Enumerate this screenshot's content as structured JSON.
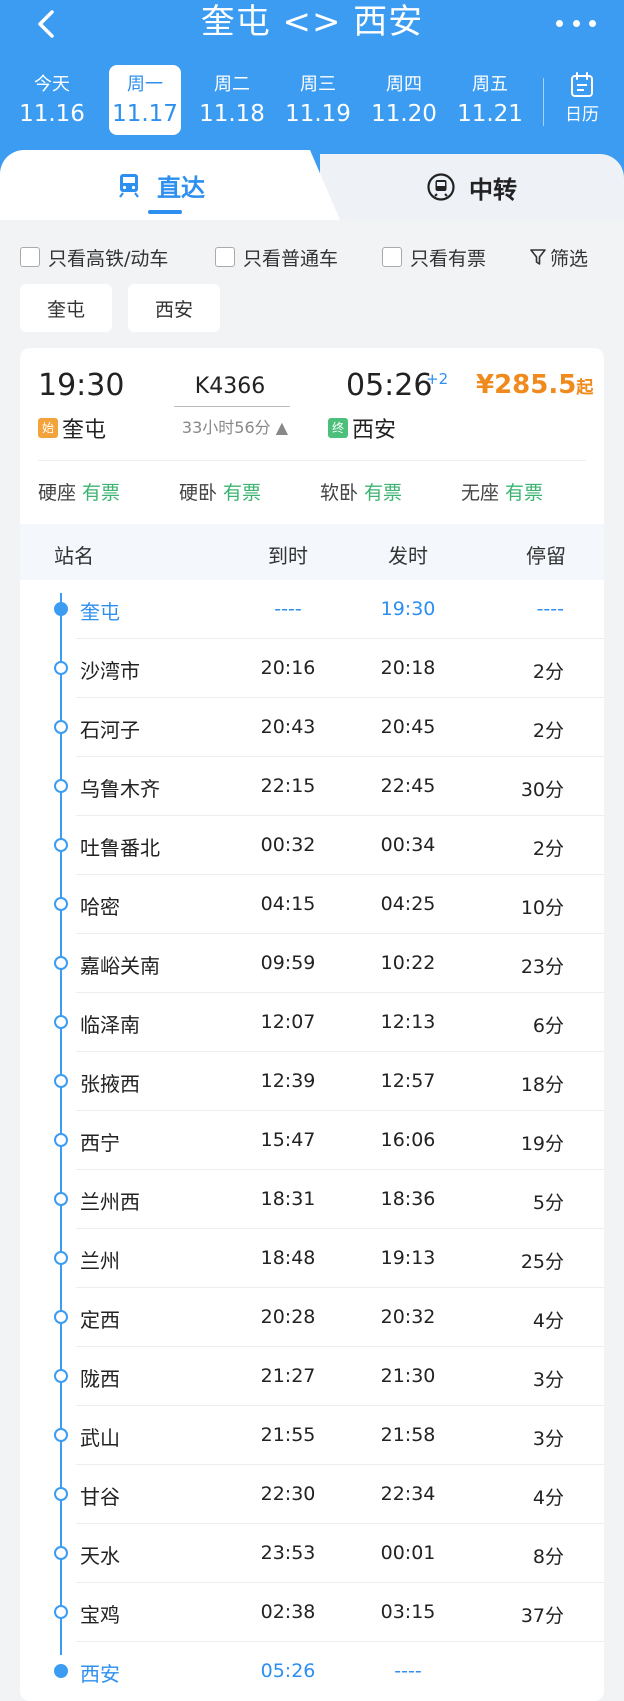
{
  "header": {
    "title": "奎屯 <> 西安",
    "back_icon": "chevron-left-icon",
    "more_icon": "more-dots-icon"
  },
  "days": [
    {
      "weekday": "今天",
      "date": "11.16",
      "active": false
    },
    {
      "weekday": "周一",
      "date": "11.17",
      "active": true
    },
    {
      "weekday": "周二",
      "date": "11.18",
      "active": false
    },
    {
      "weekday": "周三",
      "date": "11.19",
      "active": false
    },
    {
      "weekday": "周四",
      "date": "11.20",
      "active": false
    },
    {
      "weekday": "周五",
      "date": "11.21",
      "active": false
    }
  ],
  "calendar": {
    "label": "日历",
    "icon": "calendar-icon"
  },
  "tabs": {
    "direct": "直达",
    "transfer": "中转"
  },
  "filters": {
    "high_speed": "只看高铁/动车",
    "normal": "只看普通车",
    "available": "只看有票",
    "screen": "筛选"
  },
  "chips": {
    "from": "奎屯",
    "to": "西安"
  },
  "train": {
    "dep_time": "19:30",
    "arr_time": "05:26",
    "day_offset": "+2",
    "number": "K4366",
    "duration": "33小时56分",
    "price": "¥285.5",
    "price_suffix": "起",
    "from_station": "奎屯",
    "to_station": "西安",
    "start_badge": "始",
    "end_badge": "终",
    "seats": [
      {
        "type": "硬座",
        "status": "有票"
      },
      {
        "type": "硬卧",
        "status": "有票"
      },
      {
        "type": "软卧",
        "status": "有票"
      },
      {
        "type": "无座",
        "status": "有票"
      }
    ]
  },
  "timetable": {
    "headers": {
      "station": "站名",
      "arrive": "到时",
      "depart": "发时",
      "stay": "停留"
    },
    "rows": [
      {
        "name": "奎屯",
        "arrive": "----",
        "depart": "19:30",
        "stay": "----",
        "terminal": true
      },
      {
        "name": "沙湾市",
        "arrive": "20:16",
        "depart": "20:18",
        "stay": "2分",
        "terminal": false
      },
      {
        "name": "石河子",
        "arrive": "20:43",
        "depart": "20:45",
        "stay": "2分",
        "terminal": false
      },
      {
        "name": "乌鲁木齐",
        "arrive": "22:15",
        "depart": "22:45",
        "stay": "30分",
        "terminal": false
      },
      {
        "name": "吐鲁番北",
        "arrive": "00:32",
        "depart": "00:34",
        "stay": "2分",
        "terminal": false
      },
      {
        "name": "哈密",
        "arrive": "04:15",
        "depart": "04:25",
        "stay": "10分",
        "terminal": false
      },
      {
        "name": "嘉峪关南",
        "arrive": "09:59",
        "depart": "10:22",
        "stay": "23分",
        "terminal": false
      },
      {
        "name": "临泽南",
        "arrive": "12:07",
        "depart": "12:13",
        "stay": "6分",
        "terminal": false
      },
      {
        "name": "张掖西",
        "arrive": "12:39",
        "depart": "12:57",
        "stay": "18分",
        "terminal": false
      },
      {
        "name": "西宁",
        "arrive": "15:47",
        "depart": "16:06",
        "stay": "19分",
        "terminal": false
      },
      {
        "name": "兰州西",
        "arrive": "18:31",
        "depart": "18:36",
        "stay": "5分",
        "terminal": false
      },
      {
        "name": "兰州",
        "arrive": "18:48",
        "depart": "19:13",
        "stay": "25分",
        "terminal": false
      },
      {
        "name": "定西",
        "arrive": "20:28",
        "depart": "20:32",
        "stay": "4分",
        "terminal": false
      },
      {
        "name": "陇西",
        "arrive": "21:27",
        "depart": "21:30",
        "stay": "3分",
        "terminal": false
      },
      {
        "name": "武山",
        "arrive": "21:55",
        "depart": "21:58",
        "stay": "3分",
        "terminal": false
      },
      {
        "name": "甘谷",
        "arrive": "22:30",
        "depart": "22:34",
        "stay": "4分",
        "terminal": false
      },
      {
        "name": "天水",
        "arrive": "23:53",
        "depart": "00:01",
        "stay": "8分",
        "terminal": false
      },
      {
        "name": "宝鸡",
        "arrive": "02:38",
        "depart": "03:15",
        "stay": "37分",
        "terminal": false
      },
      {
        "name": "西安",
        "arrive": "05:26",
        "depart": "----",
        "stay": "",
        "terminal": true
      }
    ]
  },
  "colors": {
    "primary": "#3b9cf2",
    "price": "#f08a1c",
    "available": "#3cb371"
  }
}
